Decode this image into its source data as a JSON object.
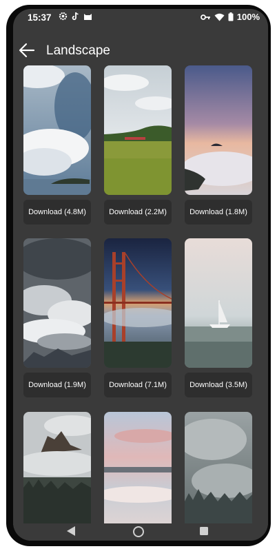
{
  "status_bar": {
    "time": "15:37",
    "left_icons": [
      "settings-icon",
      "tiktok-icon",
      "cat-icon"
    ],
    "right_icons": [
      "key-icon",
      "wifi-icon",
      "battery-icon"
    ],
    "battery": "100%"
  },
  "app_bar": {
    "title": "Landscape",
    "back_icon": "arrow-left-icon"
  },
  "wallpapers": [
    {
      "label": "Download (4.8M)",
      "scene": "clouds-sea"
    },
    {
      "label": "Download (2.2M)",
      "scene": "meadow-hill"
    },
    {
      "label": "Download (1.8M)",
      "scene": "sunset-fog-sea"
    },
    {
      "label": "Download (1.9M)",
      "scene": "stormy-clouds"
    },
    {
      "label": "Download (7.1M)",
      "scene": "golden-gate-fog"
    },
    {
      "label": "Download (3.5M)",
      "scene": "sailboat-fog"
    },
    {
      "label": "",
      "scene": "mountain-peak-clouds"
    },
    {
      "label": "",
      "scene": "pink-sky-lake"
    },
    {
      "label": "",
      "scene": "foggy-forest"
    }
  ],
  "nav_bar": {
    "back": "triangle-back-icon",
    "home": "circle-home-icon",
    "recents": "square-recents-icon"
  },
  "colors": {
    "background": "#3a3a3a",
    "button": "#2e2e2e",
    "text": "#ffffff"
  }
}
